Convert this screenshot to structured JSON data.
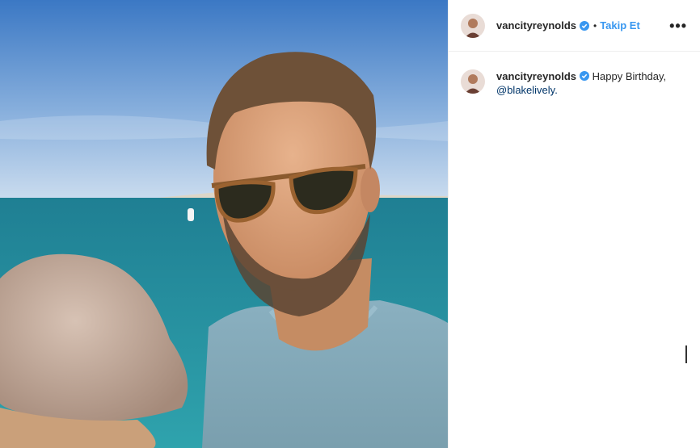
{
  "post": {
    "username": "vancityreynolds",
    "follow_label": "Takip Et",
    "separator": "•",
    "more_label": "•••",
    "caption": {
      "username": "vancityreynolds",
      "text": "Happy Birthday,",
      "mention": "@blakelively."
    }
  },
  "colors": {
    "follow": "#3897f0",
    "verified": "#3897f0",
    "mention": "#003569"
  },
  "icons": {
    "verified": "verified-badge-icon",
    "more": "more-options-icon"
  }
}
